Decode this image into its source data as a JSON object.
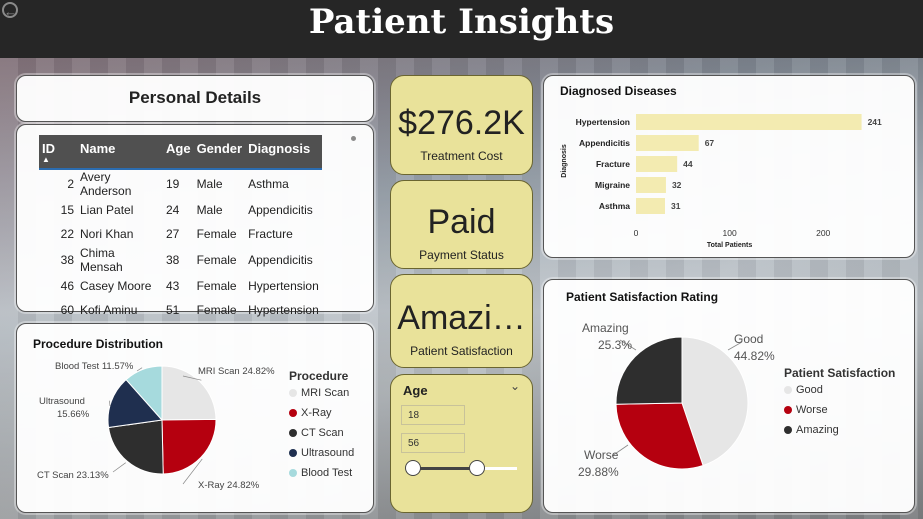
{
  "header": {
    "title": "Patient Insights"
  },
  "personal_details": {
    "title": "Personal Details",
    "columns": [
      "ID",
      "Name",
      "Age",
      "Gender",
      "Diagnosis"
    ],
    "rows": [
      [
        "2",
        "Avery Anderson",
        "19",
        "Male",
        "Asthma"
      ],
      [
        "15",
        "Lian Patel",
        "24",
        "Male",
        "Appendicitis"
      ],
      [
        "22",
        "Nori Khan",
        "27",
        "Female",
        "Fracture"
      ],
      [
        "38",
        "Chima Mensah",
        "38",
        "Female",
        "Appendicitis"
      ],
      [
        "46",
        "Casey Moore",
        "43",
        "Female",
        "Hypertension"
      ],
      [
        "60",
        "Kofi Aminu",
        "51",
        "Female",
        "Hypertension"
      ]
    ]
  },
  "kpis": {
    "treatment_cost": {
      "value": "$276.2K",
      "label": "Treatment Cost"
    },
    "payment_status": {
      "value": "Paid",
      "label": "Payment Status"
    },
    "patient_satisfaction": {
      "value": "Amazi…",
      "label": "Patient Satisfaction"
    }
  },
  "age_slicer": {
    "title": "Age",
    "min": "18",
    "max": "56"
  },
  "colors": {
    "header_bg": "#262626",
    "kpi_bg": "#e9e29a",
    "bar": "#f3ebb1",
    "red": "#b5000f",
    "navy": "#1f2f4f",
    "dark": "#2e2e2e",
    "light": "#e6e6e6",
    "teal": "#a6dadd"
  },
  "chart_data": [
    {
      "type": "bar",
      "orientation": "horizontal",
      "title": "Diagnosed Diseases",
      "categories": [
        "Hypertension",
        "Appendicitis",
        "Fracture",
        "Migraine",
        "Asthma"
      ],
      "values": [
        241,
        67,
        44,
        32,
        31
      ],
      "data_labels": [
        "241",
        "67",
        "44",
        "32",
        "31"
      ],
      "xlabel": "Total Patients",
      "ylabel": "Diagnosis",
      "xticks": [
        "0",
        "100",
        "200"
      ],
      "xlim": [
        0,
        250
      ]
    },
    {
      "type": "pie",
      "title": "Procedure Distribution",
      "legend_title": "Procedure",
      "categories": [
        "MRI Scan",
        "X-Ray",
        "CT Scan",
        "Ultrasound",
        "Blood Test"
      ],
      "values": [
        24.82,
        24.82,
        23.13,
        15.66,
        11.57
      ],
      "labels": [
        "MRI Scan 24.82%",
        "X-Ray 24.82%",
        "CT Scan 23.13%",
        "Ultrasound 15.66%",
        "Blood Test 11.57%"
      ],
      "colors": [
        "#e6e6e6",
        "#b5000f",
        "#2e2e2e",
        "#1f2f4f",
        "#a6dadd"
      ],
      "legend_placement": "right"
    },
    {
      "type": "pie",
      "title": "Patient Satisfaction Rating",
      "legend_title": "Patient Satisfaction",
      "categories": [
        "Good",
        "Worse",
        "Amazing"
      ],
      "values": [
        44.82,
        29.88,
        25.3
      ],
      "labels": [
        [
          "Good",
          "44.82%"
        ],
        [
          "Worse",
          "29.88%"
        ],
        [
          "Amazing",
          "25.3%"
        ]
      ],
      "colors": [
        "#e6e6e6",
        "#b5000f",
        "#2e2e2e"
      ],
      "legend_placement": "right"
    }
  ]
}
